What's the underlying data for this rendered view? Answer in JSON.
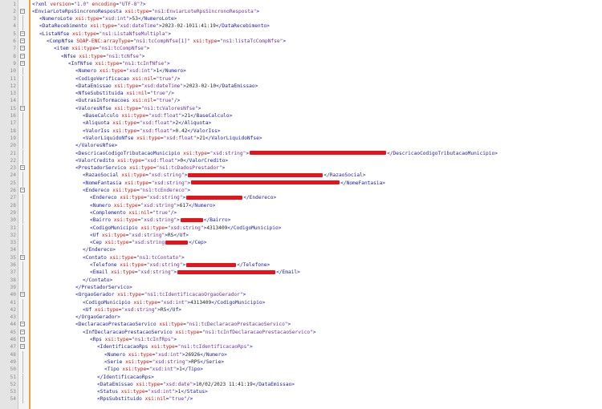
{
  "editor": {
    "theme": {
      "tag_color": "#1a1aa6",
      "attr_color": "#d01010",
      "value_color": "#6b2fa0",
      "redaction_color": "#e8121a",
      "gutter_color": "#e4e4e4",
      "change_bar_color": "#f29c3a"
    },
    "lines": [
      {
        "n": "1",
        "indent": 0,
        "fold": "",
        "text": "<?xml version=\"1.0\" encoding=\"UTF-8\"?>"
      },
      {
        "n": "2",
        "indent": 0,
        "fold": "open",
        "text": "<EnviarLoteRpsSincronoResposta xsi:type=\"ns1:EnviarLoteRpsSincronoResposta\">"
      },
      {
        "n": "3",
        "indent": 1,
        "fold": "line",
        "text": "<NumeroLote xsi:type=\"xsd:int\">53</NumeroLote>"
      },
      {
        "n": "4",
        "indent": 1,
        "fold": "line",
        "text": "<DataRecebimento xsi:type=\"xsd:dateTime\">2023-02-1011:41:19</DataRecebimento>"
      },
      {
        "n": "5",
        "indent": 1,
        "fold": "open",
        "text": "<ListaNfse xsi:type=\"ns1:ListaNfseMultipla\">"
      },
      {
        "n": "6",
        "indent": 2,
        "fold": "open",
        "text": "<CompNfse SOAP-ENC:arrayType=\"ns1:tcCompNfse[1]\" xsi:type=\"ns1:listaTcCompNfse\">"
      },
      {
        "n": "7",
        "indent": 3,
        "fold": "open",
        "text": "<item xsi:type=\"ns1:tcCompNfse\">"
      },
      {
        "n": "8",
        "indent": 4,
        "fold": "open",
        "text": "<Nfse xsi:type=\"ns1:tcNfse\">"
      },
      {
        "n": "9",
        "indent": 5,
        "fold": "open",
        "text": "<InfNfse xsi:type=\"ns1:tcInfNfse\">"
      },
      {
        "n": "10",
        "indent": 6,
        "fold": "line",
        "text": "<Numero xsi:type=\"xsd:int\">1</Numero>"
      },
      {
        "n": "11",
        "indent": 6,
        "fold": "line",
        "text": "<CodigoVerificacao xsi:nil=\"true\"/>"
      },
      {
        "n": "12",
        "indent": 6,
        "fold": "line",
        "text": "<DataEmissao xsi:type=\"xsd:dateTime\">2023-02-10</DataEmissao>"
      },
      {
        "n": "13",
        "indent": 6,
        "fold": "line",
        "text": "<NfseSubstituida xsi:nil=\"true\"/>"
      },
      {
        "n": "14",
        "indent": 6,
        "fold": "line",
        "text": "<OutrasInformacoes xsi:nil=\"true\"/>"
      },
      {
        "n": "15",
        "indent": 6,
        "fold": "open",
        "text": "<ValoresNfse xsi:type=\"ns1:tcValoresNfse\">"
      },
      {
        "n": "16",
        "indent": 7,
        "fold": "line",
        "text": "<BaseCalculo xsi:type=\"xsd:float\">21</BaseCalculo>"
      },
      {
        "n": "17",
        "indent": 7,
        "fold": "line",
        "text": "<Aliquota xsi:type=\"xsd:float\">2</Aliquota>"
      },
      {
        "n": "18",
        "indent": 7,
        "fold": "line",
        "text": "<ValorIss xsi:type=\"xsd:float\">0.42</ValorIss>"
      },
      {
        "n": "19",
        "indent": 7,
        "fold": "line",
        "text": "<ValorLiquidoNfse xsi:type=\"xsd:float\">21</ValorLiquidoNfse>"
      },
      {
        "n": "20",
        "indent": 6,
        "fold": "line",
        "text": "</ValoresNfse>"
      },
      {
        "n": "21",
        "indent": 6,
        "fold": "line",
        "text": "<DescricaoCodigoTributacaoMunicipio xsi:type=\"xsd:string\">",
        "redact": 170,
        "tail": "</DescricaoCodigoTributacaoMunicipio>"
      },
      {
        "n": "22",
        "indent": 6,
        "fold": "line",
        "text": "<ValorCredito xsi:type=\"xsd:float\">0</ValorCredito>"
      },
      {
        "n": "23",
        "indent": 6,
        "fold": "open",
        "text": "<PrestadorServico xsi:type=\"ns1:tcDadosPrestador\">"
      },
      {
        "n": "24",
        "indent": 7,
        "fold": "line",
        "text": "<RazaoSocial xsi:type=\"xsd:string\">",
        "redact": 168,
        "tail": "</RazaoSocial>"
      },
      {
        "n": "25",
        "indent": 7,
        "fold": "line",
        "text": "<NomeFantasia xsi:type=\"xsd:string\">",
        "redact": 185,
        "tail": "</NomeFantasia>"
      },
      {
        "n": "26",
        "indent": 7,
        "fold": "open",
        "text": "<Endereco xsi:type=\"ns1:tcEndereco\">"
      },
      {
        "n": "27",
        "indent": 8,
        "fold": "line",
        "text": "<Endereco xsi:type=\"xsd:string\">",
        "redact": 70,
        "tail": "</Endereco>"
      },
      {
        "n": "28",
        "indent": 8,
        "fold": "line",
        "text": "<Numero xsi:type=\"xsd:string\">617</Numero>"
      },
      {
        "n": "29",
        "indent": 8,
        "fold": "line",
        "text": "<Complemento xsi:nil=\"true\"/>"
      },
      {
        "n": "30",
        "indent": 8,
        "fold": "line",
        "text": "<Bairro xsi:type=\"xsd:string\">",
        "redact": 28,
        "tail": "</Bairro>"
      },
      {
        "n": "31",
        "indent": 8,
        "fold": "line",
        "text": "<CodigoMunicipio xsi:type=\"xsd:string\">4313409</CodigoMunicipio>"
      },
      {
        "n": "32",
        "indent": 8,
        "fold": "line",
        "text": "<Uf xsi:type=\"xsd:string\">RS</Uf>"
      },
      {
        "n": "33",
        "indent": 8,
        "fold": "line",
        "text": "<Cep xsi:type=\"xsd:string",
        "redact": 28,
        "tail": "</Cep>"
      },
      {
        "n": "34",
        "indent": 7,
        "fold": "line",
        "text": "</Endereco>"
      },
      {
        "n": "35",
        "indent": 7,
        "fold": "open",
        "text": "<Contato xsi:type=\"ns1:tcContato\">"
      },
      {
        "n": "36",
        "indent": 8,
        "fold": "line",
        "text": "<Telefone xsi:type=\"xsd:string\">",
        "redact": 62,
        "tail": "</Telefone>"
      },
      {
        "n": "37",
        "indent": 8,
        "fold": "line",
        "text": "<Email xsi:type=\"xsd:string\">",
        "redact": 122,
        "tail": "</Email>"
      },
      {
        "n": "38",
        "indent": 7,
        "fold": "line",
        "text": "</Contato>"
      },
      {
        "n": "39",
        "indent": 6,
        "fold": "line",
        "text": "</PrestadorServico>"
      },
      {
        "n": "40",
        "indent": 6,
        "fold": "open",
        "text": "<OrgaoGerador xsi:type=\"ns1:tcIdentificacaoOrgaoGerador\">"
      },
      {
        "n": "41",
        "indent": 7,
        "fold": "line",
        "text": "<CodigoMunicipio xsi:type=\"xsd:int\">4313409</CodigoMunicipio>"
      },
      {
        "n": "42",
        "indent": 7,
        "fold": "line",
        "text": "<Uf xsi:type=\"xsd:string\">RS</Uf>"
      },
      {
        "n": "43",
        "indent": 6,
        "fold": "line",
        "text": "</OrgaoGerador>"
      },
      {
        "n": "44",
        "indent": 6,
        "fold": "open",
        "text": "<DeclaracaoPrestacaoServico xsi:type=\"ns1:tcDeclaracaoPrestacaoServico\">"
      },
      {
        "n": "45",
        "indent": 7,
        "fold": "open",
        "text": "<InfDeclaracaoPrestacaoServico xsi:type=\"ns1:tcInfDeclaracaoPrestacaoServico\">"
      },
      {
        "n": "46",
        "indent": 8,
        "fold": "open",
        "text": "<Rps xsi:type=\"ns1:tcInfRps\">"
      },
      {
        "n": "47",
        "indent": 9,
        "fold": "open",
        "text": "<IdentificacaoRps xsi:type=\"ns1:tcIdentificacaoRps\">"
      },
      {
        "n": "48",
        "indent": 10,
        "fold": "line",
        "text": "<Numero xsi:type=\"xsd:int\">26926</Numero>"
      },
      {
        "n": "49",
        "indent": 10,
        "fold": "line",
        "text": "<Serie xsi:type=\"xsd:string\">RPS</Serie>"
      },
      {
        "n": "50",
        "indent": 10,
        "fold": "line",
        "text": "<Tipo xsi:type=\"xsd:int\">1</Tipo>"
      },
      {
        "n": "51",
        "indent": 9,
        "fold": "line",
        "text": "</IdentificacaoRps>"
      },
      {
        "n": "52",
        "indent": 9,
        "fold": "line",
        "text": "<DataEmissao xsi:type=\"xsd:date\">10/02/2023 11:41:19</DataEmissao>"
      },
      {
        "n": "53",
        "indent": 9,
        "fold": "line",
        "text": "<Status xsi:type=\"xsd:int\">1</Status>"
      },
      {
        "n": "54",
        "indent": 9,
        "fold": "line",
        "text": "<RpsSubstituido xsi:nil=\"true\"/>"
      }
    ]
  }
}
